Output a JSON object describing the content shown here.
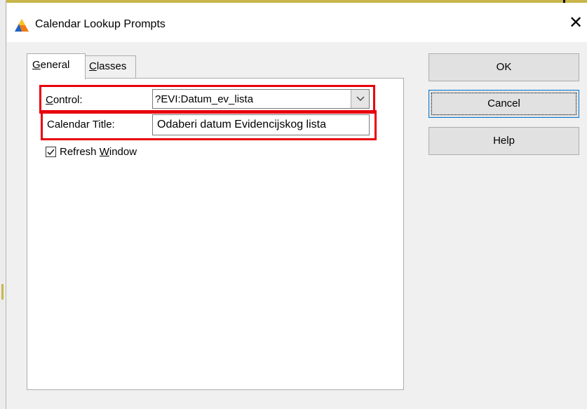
{
  "window": {
    "title": "Calendar Lookup Prompts",
    "close_glyph": "✕",
    "app_icon": "app-triangle-icon"
  },
  "tabs": [
    {
      "label": "General",
      "selected": true
    },
    {
      "label": "Classes",
      "selected": false
    }
  ],
  "form": {
    "control_label": "Control:",
    "control_value": "?EVI:Datum_ev_lista",
    "calendar_title_label": "Calendar Title:",
    "calendar_title_value": "Odaberi datum Evidencijskog lista",
    "refresh_label": "Refresh Window",
    "refresh_checked": true
  },
  "buttons": {
    "ok": "OK",
    "cancel": "Cancel",
    "help": "Help"
  },
  "colors": {
    "highlight": "#e8000d",
    "focus_blue": "#0078d7"
  }
}
